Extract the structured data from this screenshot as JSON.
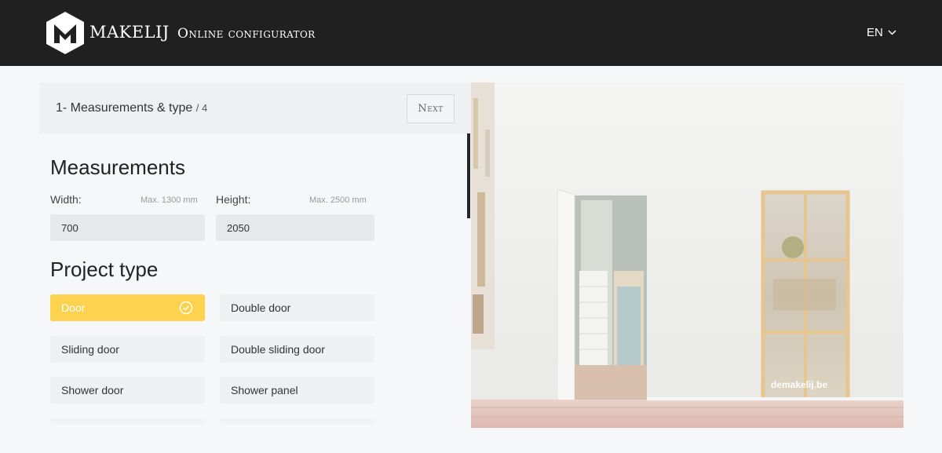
{
  "header": {
    "brand": "MAKELIJ",
    "title": "Online configurator",
    "language": "EN"
  },
  "step": {
    "label": "1- Measurements & type",
    "total": "/ 4",
    "next_label": "Next"
  },
  "measurements": {
    "title": "Measurements",
    "width": {
      "label": "Width:",
      "max": "Max. 1300 mm",
      "value": "700"
    },
    "height": {
      "label": "Height:",
      "max": "Max. 2500 mm",
      "value": "2050"
    }
  },
  "project_type": {
    "title": "Project type",
    "options": [
      {
        "label": "Door",
        "selected": true
      },
      {
        "label": "Double door",
        "selected": false
      },
      {
        "label": "Sliding door",
        "selected": false
      },
      {
        "label": "Double sliding door",
        "selected": false
      },
      {
        "label": "Shower door",
        "selected": false
      },
      {
        "label": "Shower panel",
        "selected": false
      }
    ]
  },
  "preview": {
    "watermark": "demakelij.be"
  },
  "colors": {
    "header_bg": "#202020",
    "accent": "#fcd24e",
    "door_frame": "#e7c58f"
  }
}
